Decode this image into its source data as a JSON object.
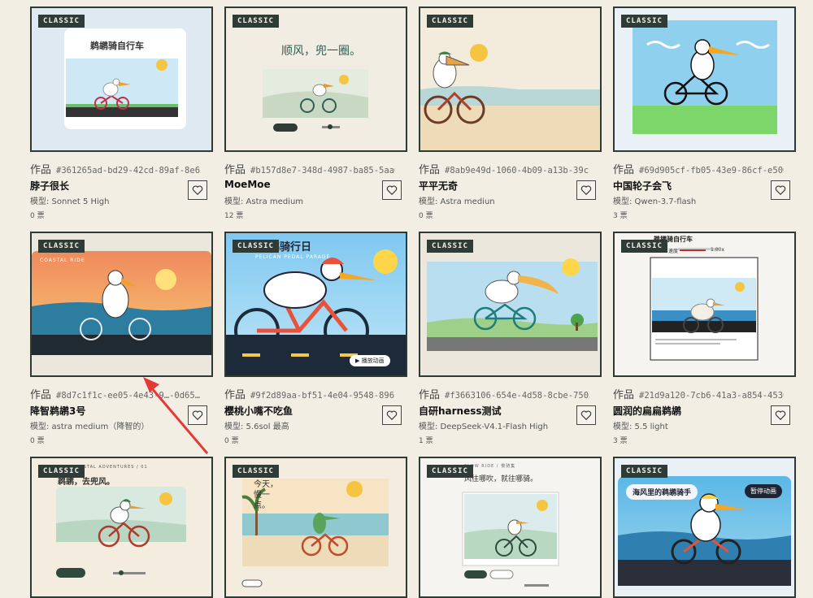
{
  "badge": "CLASSIC",
  "work_label": "作品",
  "cards": [
    {
      "id": "#361265ad-bd29-42cd-89af-8e65…",
      "title": "脖子很长",
      "model": "模型: Sonnet 5 High",
      "votes": "0 票",
      "thumb_text": "鹈鹕骑自行车"
    },
    {
      "id": "#b157d8e7-348d-4987-ba85-5aa6…",
      "title": "MoeMoe",
      "model": "模型: Astra medium",
      "votes": "12 票",
      "thumb_text": "顺风，兜一圈。"
    },
    {
      "id": "#8ab9e49d-1060-4b09-a13b-39cb…",
      "title": "平平无奇",
      "model": "模型: Astra mediun",
      "votes": "0 票",
      "thumb_text": ""
    },
    {
      "id": "#69d905cf-fb05-43e9-86cf-e506…",
      "title": "中国轮子会飞",
      "model": "模型: Qwen-3.7-flash",
      "votes": "3 票",
      "thumb_text": ""
    },
    {
      "id": "#8d7c1f1c-ee05-4e43-9…-0d65…",
      "title": "降智鹈鹕3号",
      "model": "模型: astra medium（降智的）",
      "votes": "0 票",
      "thumb_text": "COASTAL RIDE"
    },
    {
      "id": "#9f2d89aa-bf51-4e04-9548-896f…",
      "title": "樱桃小嘴不吃鱼",
      "model": "模型: 5.6sol 最高",
      "votes": "0 票",
      "thumb_text": "鹈鹕骑行日",
      "thumb_sub": "PELICAN PEDAL PARADE",
      "thumb_btn": "播放动画"
    },
    {
      "id": "#f3663106-654e-4d58-8cbe-7503…",
      "title": "自研harness测试",
      "model": "模型: DeepSeek-V4.1-Flash High",
      "votes": "1 票",
      "thumb_text": ""
    },
    {
      "id": "#21d9a120-7cb6-41a3-a854-4530…",
      "title": "圆润的扁扁鹈鹕",
      "model": "模型: 5.5 light",
      "votes": "3 票",
      "thumb_text": "鹈鹕骑自行车",
      "thumb_sub": "速度",
      "thumb_speed": "1.00x"
    },
    {
      "id": "",
      "title": "",
      "model": "",
      "votes": "",
      "thumb_text": "鹈鹕，去兜风。",
      "thumb_sub": "COASTAL ADVENTURES / 01"
    },
    {
      "id": "",
      "title": "",
      "model": "",
      "votes": "",
      "thumb_text": "今天，慢一点。"
    },
    {
      "id": "",
      "title": "",
      "model": "",
      "votes": "",
      "thumb_text": "风往哪吹，就往哪骑。",
      "thumb_sub": "SLOW RIDE / 慢骑集"
    },
    {
      "id": "",
      "title": "",
      "model": "",
      "votes": "",
      "thumb_text": "海风里的鹈鹕骑手",
      "thumb_btn": "暂停动画"
    }
  ],
  "colors": {
    "bg": "#f2eee4",
    "border": "#2f3a34",
    "badge_bg": "#2f3b37",
    "arrow": "#e53935"
  }
}
